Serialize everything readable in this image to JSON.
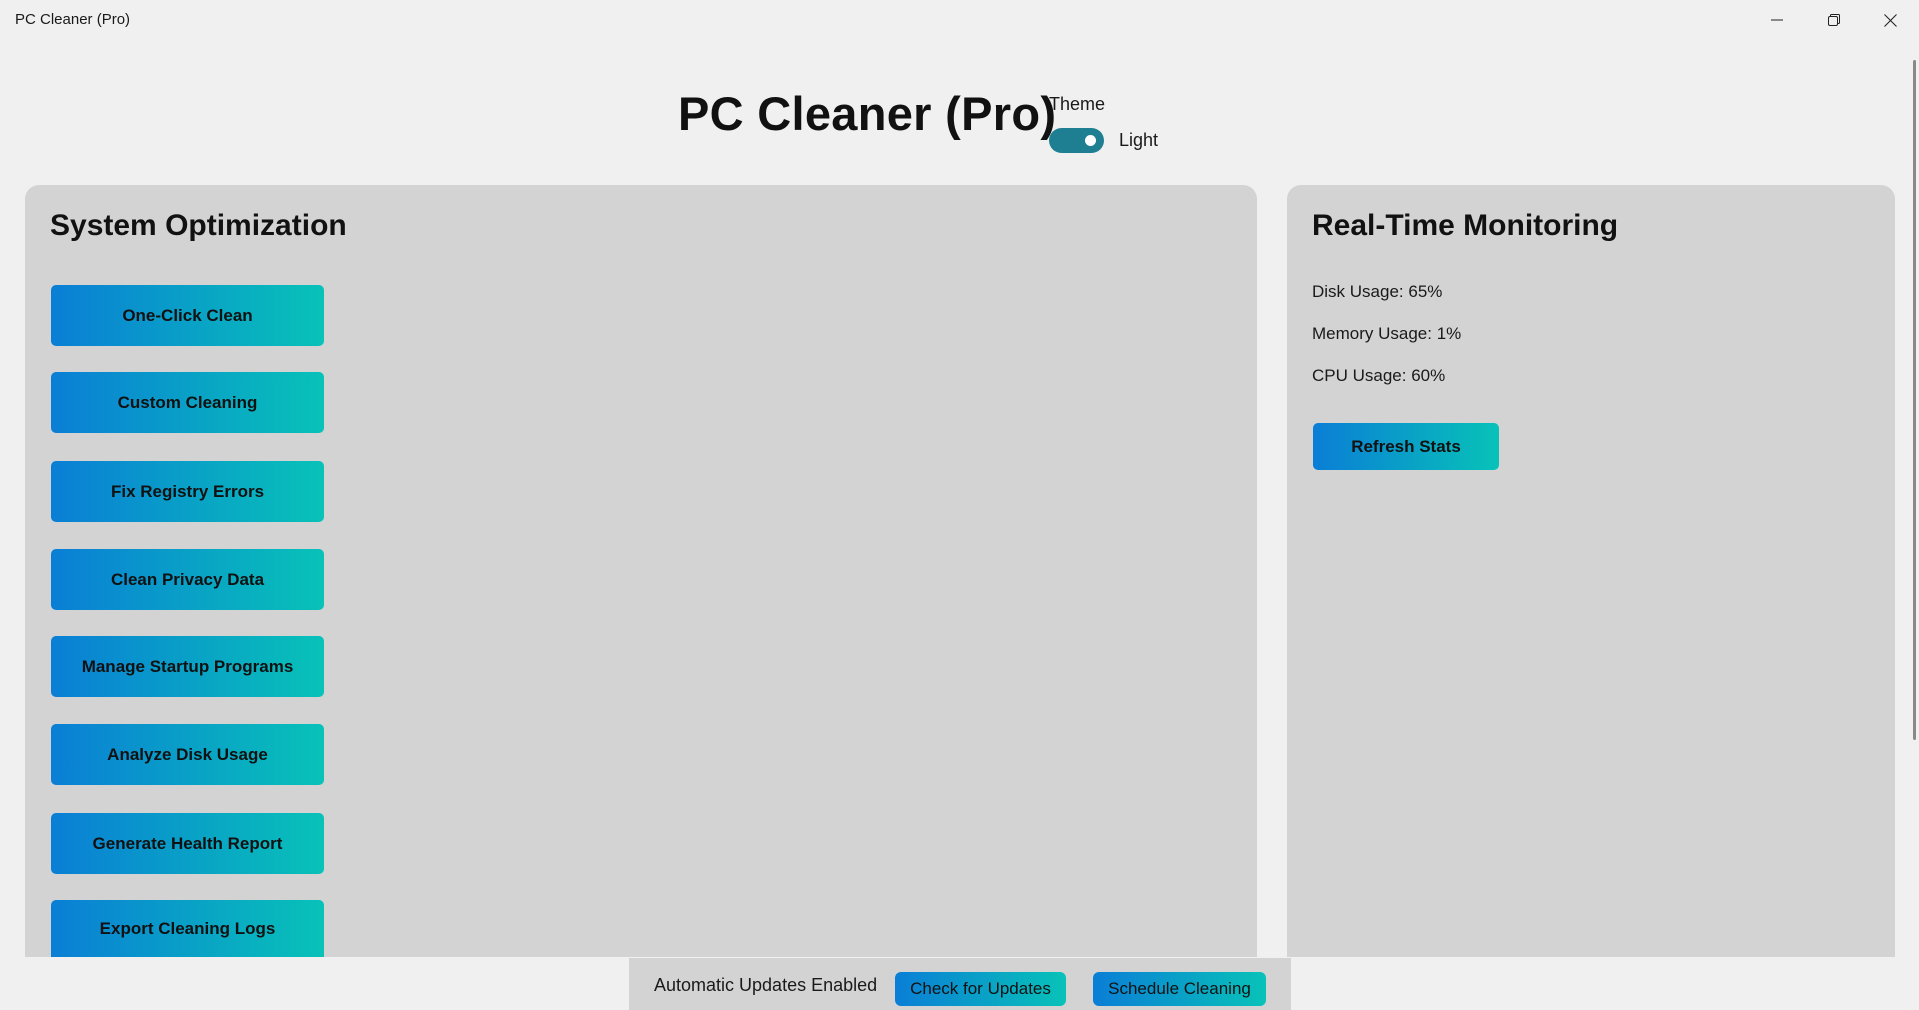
{
  "window": {
    "title": "PC Cleaner (Pro)",
    "controls": {
      "minimize_icon": "minimize-icon",
      "restore_icon": "restore-icon",
      "close_icon": "close-icon"
    }
  },
  "header": {
    "title": "PC Cleaner (Pro)",
    "theme_label": "Theme",
    "theme_value": "Light",
    "theme_toggle_on": true
  },
  "optimization": {
    "title": "System Optimization",
    "buttons": [
      "One-Click Clean",
      "Custom Cleaning",
      "Fix Registry Errors",
      "Clean Privacy Data",
      "Manage Startup Programs",
      "Analyze Disk Usage",
      "Generate Health Report",
      "Export Cleaning Logs"
    ]
  },
  "monitoring": {
    "title": "Real-Time Monitoring",
    "disk": "Disk Usage: 65%",
    "memory": "Memory Usage: 1%",
    "cpu": "CPU Usage: 60%",
    "refresh_label": "Refresh Stats"
  },
  "footer": {
    "status": "Automatic Updates Enabled",
    "check_updates_label": "Check for Updates",
    "schedule_label": "Schedule Cleaning"
  },
  "colors": {
    "accent_start": "#0a7ed6",
    "accent_end": "#08c2b8",
    "toggle": "#1f7f92",
    "panel": "#d3d3d3",
    "background": "#f0f0f0"
  }
}
